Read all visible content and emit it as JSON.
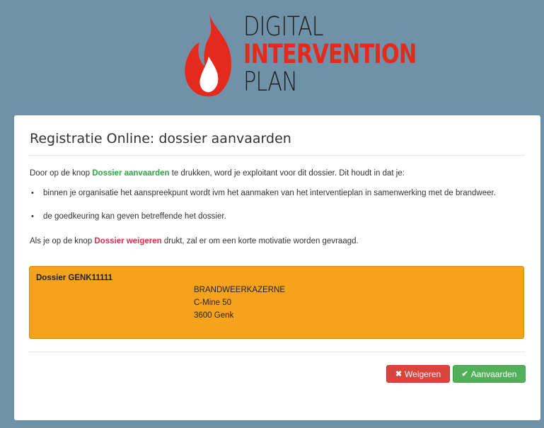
{
  "logo": {
    "line1": "DIGITAL",
    "line2": "INTERVENTION",
    "line3": "PLAN"
  },
  "page": {
    "title": "Registratie Online: dossier aanvaarden",
    "intro_before": "Door op de knop ",
    "intro_highlight": "Dossier aanvaarden",
    "intro_after": " te drukken, word je exploitant voor dit dossier. Dit houdt in dat je:",
    "bullets": [
      "binnen je organisatie het aanspreekpunt wordt ivm het aanmaken van het interventieplan in samenwerking met de brandweer.",
      "de goedkeuring kan geven betreffende het dossier."
    ],
    "refuse_before": "Als je op de knop ",
    "refuse_highlight": "Dossier weigeren",
    "refuse_after": " drukt, zal er om een korte motivatie worden gevraagd."
  },
  "dossier": {
    "title": "Dossier GENK11111",
    "address": [
      "BRANDWEERKAZERNE",
      "C-Mine 50",
      "3600 Genk"
    ]
  },
  "buttons": {
    "refuse_label": "Weigeren",
    "accept_label": "Aanvaarden"
  },
  "icons": {
    "logo": "flame-icon",
    "refuse": "times-icon",
    "accept": "check-icon"
  },
  "colors": {
    "background": "#7092a8",
    "flame": "#e42a1d",
    "highlight_accept": "#2fa640",
    "highlight_refuse": "#d9304a",
    "dossier_panel": "#f5a31c",
    "refuse_button": "#d9443c",
    "accept_button": "#53b05a"
  }
}
